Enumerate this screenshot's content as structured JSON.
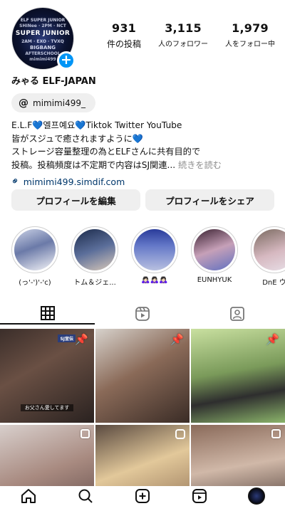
{
  "profile": {
    "avatar_lines": [
      "ELF SUPER JUNIOR",
      "SHINee · 2PM · NCT",
      "SUPER JUNIOR",
      "2AM · EXO · TVXQ",
      "BIGBANG",
      "AFTERSCHOOL",
      "mimimi499"
    ],
    "display_name": "みゃる ELF-JAPAN",
    "threads_handle": "mimimi499_",
    "bio_lines": [
      "E.L.F💙엘프예요💙Tiktok Twitter YouTube",
      "皆がスジュで癒されますように💙",
      "ストレージ容量整理の為とELFさんに共有目的で",
      "投稿。投稿頻度は不定期で内容はSJ関連... "
    ],
    "bio_more": "続きを読む",
    "link": "mimimi499.simdif.com"
  },
  "stats": [
    {
      "value": "931",
      "label": "件の投稿"
    },
    {
      "value": "3,115",
      "label": "人のフォロワー"
    },
    {
      "value": "1,979",
      "label": "人をフォロー中"
    }
  ],
  "buttons": {
    "edit": "プロフィールを編集",
    "share": "プロフィールをシェア"
  },
  "highlights": [
    {
      "label": "(っ'-')'-'c)"
    },
    {
      "label": "トム＆ジェ..."
    },
    {
      "label": "🙇🏻‍♀️🙇🏻‍♀️🙇🏻‍♀️"
    },
    {
      "label": "EUNHYUK"
    },
    {
      "label": "DnE ウ"
    }
  ],
  "grid": {
    "cell1_caption": "お父さん愛してます",
    "cell1_logo": "SJ宣伝"
  },
  "colors": {
    "accent": "#0095f6",
    "link": "#00376b",
    "heart": "#1da1f2"
  }
}
